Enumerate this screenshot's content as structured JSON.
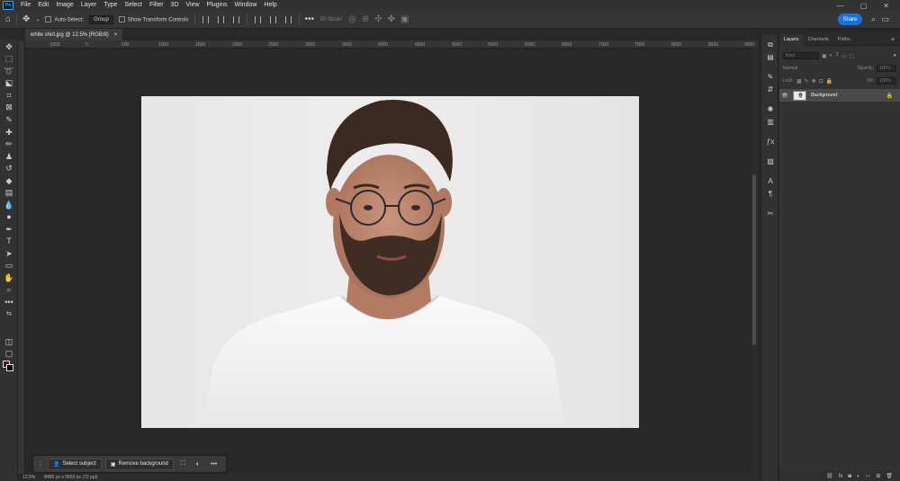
{
  "menubar": {
    "logo": "Ps",
    "items": [
      "File",
      "Edit",
      "Image",
      "Layer",
      "Type",
      "Select",
      "Filter",
      "3D",
      "View",
      "Plugins",
      "Window",
      "Help"
    ],
    "window_controls": [
      "—",
      "▢",
      "✕"
    ]
  },
  "options": {
    "auto_select_label": "Auto-Select:",
    "auto_select_value": "Group",
    "show_transform_label": "Show Transform Controls",
    "mode_3d_label": "3D Mode:",
    "share_label": "Share"
  },
  "document": {
    "tab_title": "white shirt.jpg @ 12.5% (RGB/8)",
    "close_glyph": "×"
  },
  "ruler": {
    "ticks": [
      "-1000",
      "0",
      "500",
      "1000",
      "1500",
      "2000",
      "2500",
      "3000",
      "3500",
      "4000",
      "4500",
      "5000",
      "5500",
      "6000",
      "6500",
      "7000",
      "7500",
      "8000",
      "8500",
      "9000"
    ]
  },
  "taskbar": {
    "select_subject_label": "Select subject",
    "remove_background_label": "Remove background",
    "more_glyph": "•••"
  },
  "status": {
    "zoom": "12.5%",
    "dimensions": "8495 px x 5663 px (72 ppi)"
  },
  "layers_panel": {
    "tabs": [
      "Layers",
      "Channels",
      "Paths"
    ],
    "kind_placeholder": "Kind",
    "blend_mode": "Normal",
    "opacity_label": "Opacity:",
    "opacity_value": "100%",
    "lock_label": "Lock:",
    "fill_label": "Fill:",
    "fill_value": "100%",
    "layer_name": "Background"
  },
  "colors": {
    "accent": "#1473e6",
    "foreground_swatch": "#4a1e1e",
    "background_swatch": "#000000",
    "canvas_bg": "#282828"
  }
}
